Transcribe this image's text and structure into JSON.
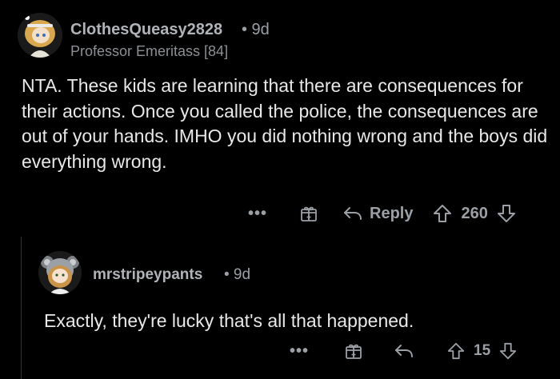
{
  "comment": {
    "username": "ClothesQueasy2828",
    "time_sep": "• 9d",
    "flair": "Professor Emeritass [84]",
    "body": "NTA.  These kids are learning that there are consequences for their actions.  Once you called the police, the consequences are out of your hands.  IMHO you did nothing wrong and the boys did everything wrong.",
    "actions": {
      "more": "•••",
      "reply_label": "Reply",
      "score": "260"
    }
  },
  "reply": {
    "username": "mrstripeypants",
    "time_sep": "• 9d",
    "body": "Exactly, they're lucky that's all that happened.",
    "actions": {
      "more": "•••",
      "score": "15"
    }
  },
  "icons": {
    "award": "award-gift-icon",
    "reply": "reply-arrow-icon",
    "upvote": "upvote-arrow-icon",
    "downvote": "downvote-arrow-icon"
  },
  "colors": {
    "background": "#000000",
    "text": "#e8e8e8",
    "muted": "#9aa0a6"
  }
}
